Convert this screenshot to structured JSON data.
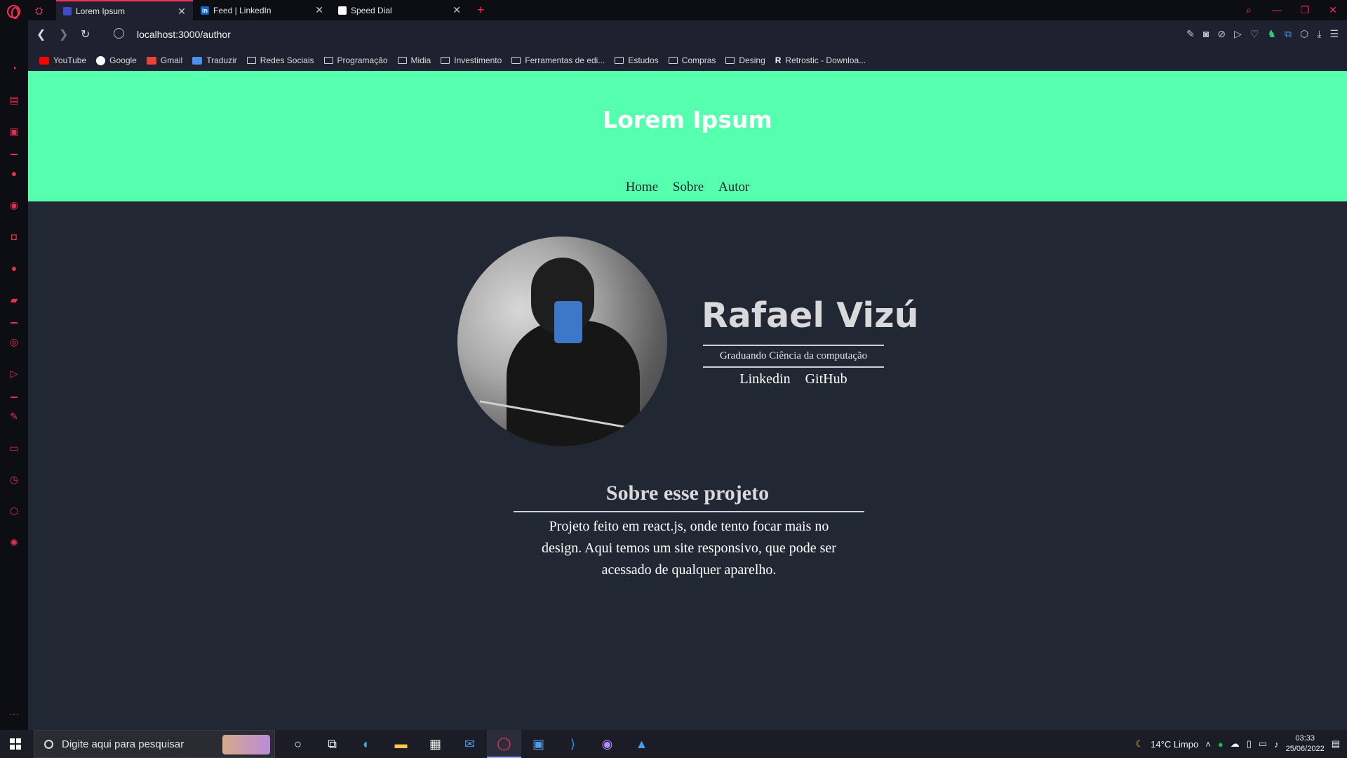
{
  "browser": {
    "tabs": [
      {
        "title": "Lorem Ipsum",
        "active": true
      },
      {
        "title": "Feed | LinkedIn",
        "active": false
      },
      {
        "title": "Speed Dial",
        "active": false
      }
    ],
    "url": "localhost:3000/author",
    "bookmarks": [
      {
        "label": "YouTube",
        "icon": "youtube-icon"
      },
      {
        "label": "Google",
        "icon": "google-icon"
      },
      {
        "label": "Gmail",
        "icon": "gmail-icon"
      },
      {
        "label": "Traduzir",
        "icon": "translate-icon"
      },
      {
        "label": "Redes Sociais",
        "icon": "folder-icon"
      },
      {
        "label": "Programação",
        "icon": "folder-icon"
      },
      {
        "label": "Midia",
        "icon": "folder-icon"
      },
      {
        "label": "Investimento",
        "icon": "folder-icon"
      },
      {
        "label": "Ferramentas de edi...",
        "icon": "folder-icon"
      },
      {
        "label": "Estudos",
        "icon": "folder-icon"
      },
      {
        "label": "Compras",
        "icon": "folder-icon"
      },
      {
        "label": "Desing",
        "icon": "folder-icon"
      },
      {
        "label": "Retrostic - Downloa...",
        "icon": "retrostic-icon"
      }
    ],
    "accent_color": "#ff2e55"
  },
  "site": {
    "brand": "Lorem Ipsum",
    "nav": [
      "Home",
      "Sobre",
      "Autor"
    ],
    "header_color": "#56ffad",
    "background_color": "#222734"
  },
  "author": {
    "name": "Rafael Vizú",
    "role": "Graduando Ciência da computação",
    "links": [
      "Linkedin",
      "GitHub"
    ]
  },
  "about": {
    "title": "Sobre esse projeto",
    "text": "Projeto feito em react.js, onde tento focar mais no design. Aqui temos um site responsivo, que pode ser acessado de qualquer aparelho."
  },
  "taskbar": {
    "search_placeholder": "Digite aqui para pesquisar",
    "weather": "14°C  Limpo",
    "time": "03:33",
    "date": "25/06/2022"
  }
}
